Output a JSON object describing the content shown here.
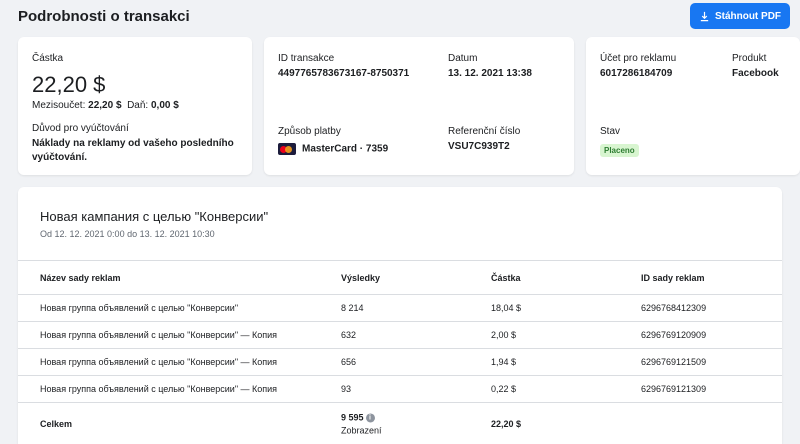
{
  "header": {
    "title": "Podrobnosti o transakci",
    "pdf_label": "Stáhnout PDF"
  },
  "amount_card": {
    "amount_label": "Částka",
    "amount": "22,20 $",
    "subtotal_label": "Mezisoučet:",
    "subtotal": "22,20 $",
    "tax_label": "Daň:",
    "tax": "0,00 $",
    "reason_label": "Důvod pro vyúčtování",
    "reason": "Náklady na reklamy od vašeho posledního vyúčtování."
  },
  "txn_card": {
    "id_label": "ID transakce",
    "id": "4497765783673167-8750371",
    "date_label": "Datum",
    "date": "13. 12. 2021 13:38",
    "payment_label": "Způsob platby",
    "payment": "MasterCard · 7359",
    "ref_label": "Referenční číslo",
    "ref": "VSU7C939T2"
  },
  "account_card": {
    "account_label": "Účet pro reklamu",
    "account": "6017286184709",
    "product_label": "Produkt",
    "product": "Facebook",
    "status_label": "Stav",
    "status": "Placeno"
  },
  "campaign": {
    "title": "Новая кампания с целью \"Конверсии\"",
    "range": "Od 12. 12. 2021 0:00 do 13. 12. 2021 10:30",
    "columns": [
      "Název sady reklam",
      "Výsledky",
      "Částka",
      "ID sady reklam"
    ],
    "rows": [
      [
        "Новая группа объявлений с целью \"Конверсии\"",
        "8 214",
        "18,04 $",
        "6296768412309"
      ],
      [
        "Новая группа объявлений с целью \"Конверсии\" — Копия",
        "632",
        "2,00 $",
        "6296769120909"
      ],
      [
        "Новая группа объявлений с целью \"Конверсии\" — Копия",
        "656",
        "1,94 $",
        "6296769121509"
      ],
      [
        "Новая группа объявлений с целью \"Конверсии\" — Копия",
        "93",
        "0,22 $",
        "6296769121309"
      ]
    ],
    "total": {
      "label": "Celkem",
      "results": "9 595",
      "results_unit": "Zobrazení",
      "amount": "22,20 $"
    }
  },
  "colors": {
    "accent": "#1877f2",
    "badge_bg": "#d8f5d0",
    "badge_text": "#2e7d32"
  }
}
